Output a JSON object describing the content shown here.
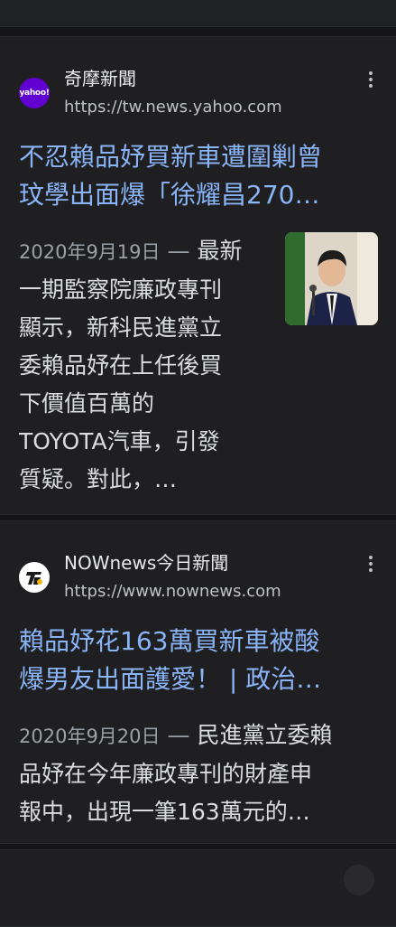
{
  "cards": [
    {
      "source_name": "奇摩新聞",
      "source_url": "https://tw.news.yahoo.com",
      "logo_text": "yahoo!",
      "logo_color": "#6001d2",
      "headline_lines": [
        "不忍賴品妤買新車遭圍剿曾",
        "玟學出面爆「徐耀昌270…"
      ],
      "date": "2020年9月19日",
      "snippet_first": "最新",
      "snippet_lines": [
        "一期監察院廉政專刊",
        "顯示，新科民進黨立",
        "委賴品妤在上任後買",
        "下價值百萬的",
        "TOYOTA汽車，引發",
        "質疑。對此，…"
      ]
    },
    {
      "source_name": "NOWnews今日新聞",
      "source_url": "https://www.nownews.com",
      "headline_lines": [
        "賴品妤花163萬買新車被酸",
        "爆男友出面護愛！ | 政治…"
      ],
      "date": "2020年9月20日",
      "snippet_first": "民進黨立委賴",
      "snippet_lines": [
        "品妤在今年廉政專刊的財產申",
        "報中，出現一筆163萬元的…"
      ]
    }
  ],
  "colors": {
    "headline": "#8ab4f8",
    "card_bg": "#1f1f21",
    "page_bg": "#141416"
  }
}
